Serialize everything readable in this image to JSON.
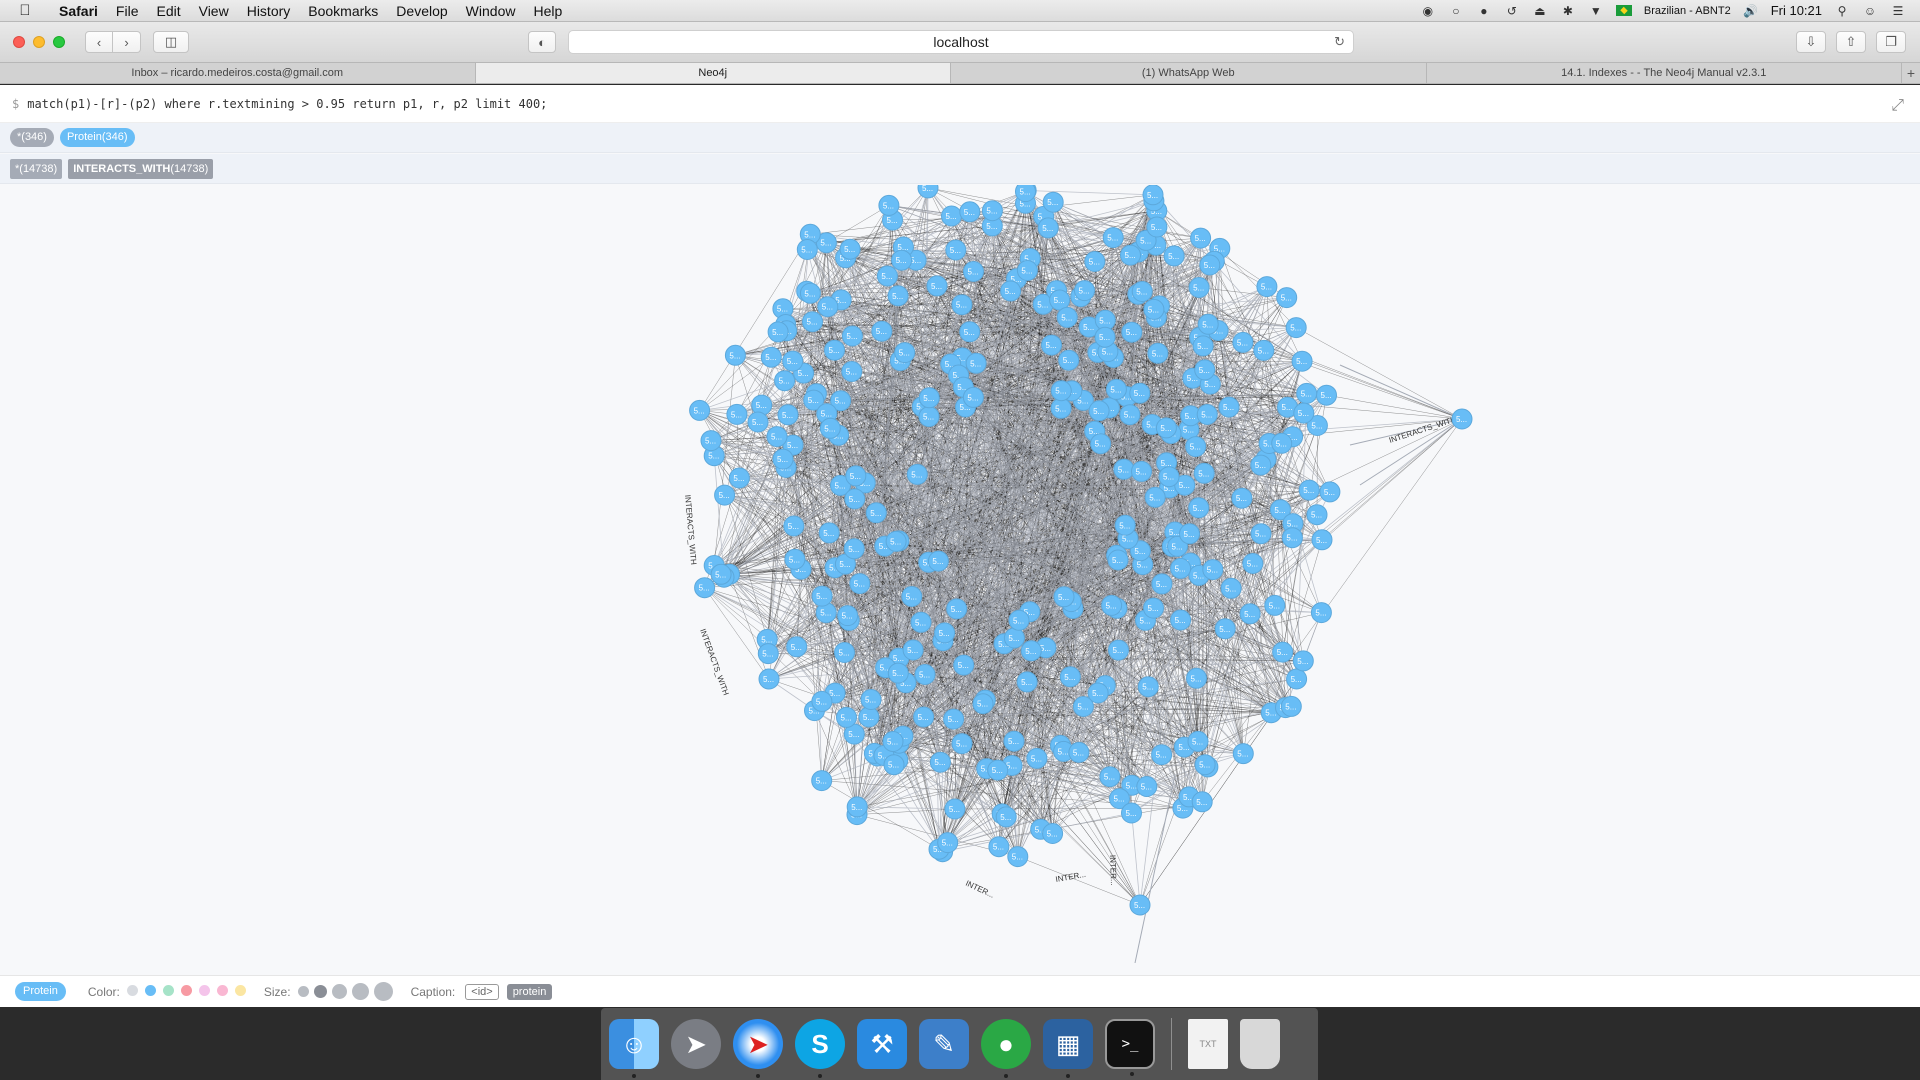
{
  "menubar": {
    "app_name": "Safari",
    "menus": [
      "File",
      "Edit",
      "View",
      "History",
      "Bookmarks",
      "Develop",
      "Window",
      "Help"
    ],
    "input_source": "Brazilian - ABNT2",
    "clock": "Fri 10:21"
  },
  "toolbar": {
    "url": "localhost"
  },
  "tabs": [
    {
      "label": "Inbox – ricardo.medeiros.costa@gmail.com",
      "active": false
    },
    {
      "label": "Neo4j",
      "active": true
    },
    {
      "label": "(1) WhatsApp Web",
      "active": false
    },
    {
      "label": "14.1. Indexes - - The Neo4j Manual v2.3.1",
      "active": false
    }
  ],
  "neo4j": {
    "prompt": "$",
    "query": "match(p1)-[r]-(p2) where r.textmining > 0.95 return p1, r, p2 limit 400;",
    "labels": [
      {
        "text": "*(346)"
      },
      {
        "text": "Protein(346)"
      }
    ],
    "rel_types": [
      {
        "text": "*(14738)"
      },
      {
        "name": "INTERACTS_WITH",
        "count": "(14738)"
      }
    ],
    "node_caption": "5...",
    "edge_label": "INTERACTS_WITH",
    "edge_label_short": "INTER...",
    "node_color": "#68bdf6"
  },
  "legend": {
    "label_pill": "Protein",
    "color_label": "Color:",
    "colors": [
      "#d8dbe0",
      "#68bdf6",
      "#a6e3c8",
      "#f79aa3",
      "#f4c4ea",
      "#f9b7d2",
      "#fbe6a2"
    ],
    "size_label": "Size:",
    "caption_label": "Caption:",
    "caption_id": "<id>",
    "caption_property": "protein"
  },
  "dock": {
    "items": [
      "finder-icon",
      "launchpad-icon",
      "safari-icon",
      "skype-icon",
      "xcode-icon",
      "instruments-icon",
      "neo4j-icon",
      "virtualbox-icon",
      "terminal-icon",
      "txt-file-icon",
      "trash-icon"
    ]
  }
}
